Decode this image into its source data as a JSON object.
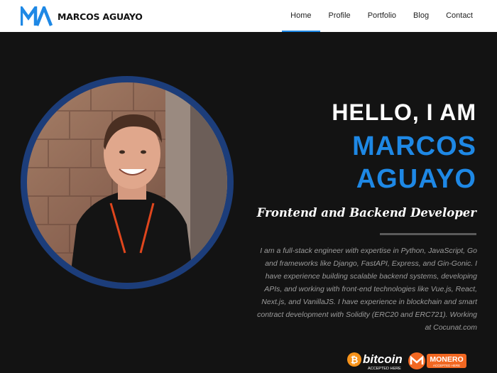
{
  "brand": {
    "name": "MARCOS AGUAYO",
    "accent": "#1e88e5"
  },
  "nav": {
    "items": [
      "Home",
      "Profile",
      "Portfolio",
      "Blog",
      "Contact"
    ],
    "active": "Home"
  },
  "hero": {
    "greeting": "HELLO, I AM",
    "name_line1": "MARCOS",
    "name_line2": "AGUAYO",
    "subtitle": "Frontend and Backend Developer",
    "bio": "I am a full-stack engineer with expertise in Python, JavaScript, Go and frameworks like Django, FastAPI, Express, and Gin-Gonic. I have experience building scalable backend systems, developing APIs, and working with front-end technologies like Vue.js, React, Next.js, and VanillaJS. I have experience in blockchain and smart contract development with Solidity (ERC20 and ERC721). Working at Cocunat.com"
  },
  "badges": {
    "bitcoin": {
      "label": "bitcoin",
      "sub": "ACCEPTED HERE",
      "color": "#f7931a"
    },
    "monero": {
      "label": "MONERO",
      "sub": "ACCEPTED HERE",
      "color": "#f26822"
    }
  },
  "icons": {
    "logo": "ma-logo-icon",
    "portrait": "profile-photo",
    "bitcoin": "bitcoin-icon",
    "monero": "monero-icon"
  }
}
